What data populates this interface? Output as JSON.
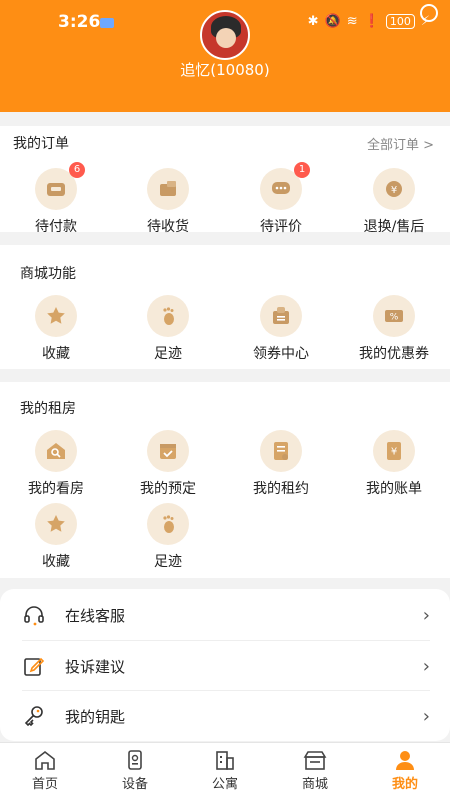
{
  "status": {
    "time": "3:26",
    "battery": "100"
  },
  "user": {
    "name": "追忆(10080)"
  },
  "orders": {
    "title": "我的订单",
    "all_label": "全部订单 >",
    "items": [
      {
        "label": "待付款",
        "badge": "6",
        "icon": "wallet-icon"
      },
      {
        "label": "待收货",
        "badge": "",
        "icon": "delivery-icon"
      },
      {
        "label": "待评价",
        "badge": "1",
        "icon": "comment-icon"
      },
      {
        "label": "退换/售后",
        "badge": "",
        "icon": "refund-icon"
      }
    ]
  },
  "mall": {
    "title": "商城功能",
    "items": [
      {
        "label": "收藏",
        "icon": "star-icon"
      },
      {
        "label": "足迹",
        "icon": "footprint-icon"
      },
      {
        "label": "领券中心",
        "icon": "coupon-center-icon"
      },
      {
        "label": "我的优惠券",
        "icon": "coupon-icon"
      }
    ]
  },
  "rental": {
    "title": "我的租房",
    "items": [
      {
        "label": "我的看房",
        "icon": "house-search-icon"
      },
      {
        "label": "我的预定",
        "icon": "calendar-icon"
      },
      {
        "label": "我的租约",
        "icon": "contract-icon"
      },
      {
        "label": "我的账单",
        "icon": "bill-icon"
      },
      {
        "label": "收藏",
        "icon": "star-icon"
      },
      {
        "label": "足迹",
        "icon": "footprint-icon"
      }
    ]
  },
  "menu": [
    {
      "label": "在线客服",
      "icon": "headset-icon"
    },
    {
      "label": "投诉建议",
      "icon": "edit-icon"
    },
    {
      "label": "我的钥匙",
      "icon": "key-icon"
    }
  ],
  "tabs": [
    {
      "label": "首页",
      "icon": "home-icon"
    },
    {
      "label": "设备",
      "icon": "device-icon"
    },
    {
      "label": "公寓",
      "icon": "apartment-icon"
    },
    {
      "label": "商城",
      "icon": "shop-icon"
    },
    {
      "label": "我的",
      "icon": "user-icon",
      "active": true
    }
  ],
  "colors": {
    "accent": "#fe8e14",
    "badge": "#ff5a4d",
    "icon_bg": "#f6ead9"
  }
}
